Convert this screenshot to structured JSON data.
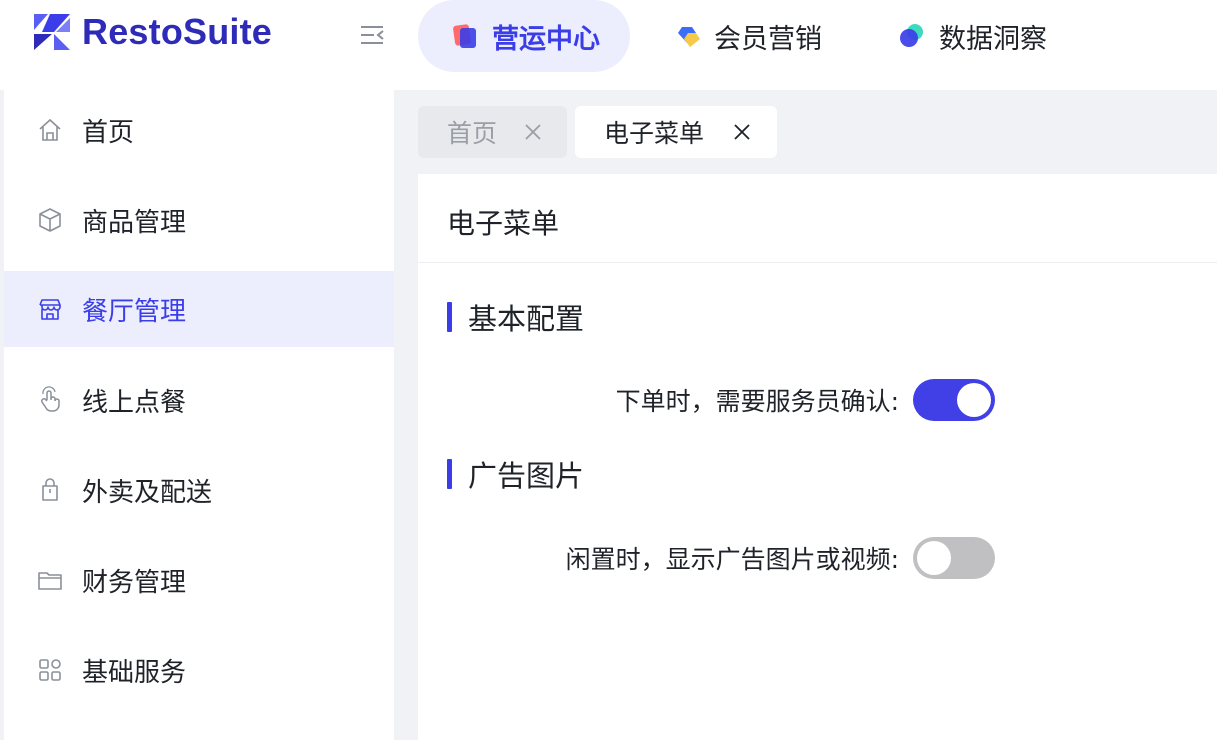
{
  "brand": {
    "name": "RestoSuite"
  },
  "top_nav": [
    {
      "label": "营运中心",
      "icon": "operations-icon",
      "active": true
    },
    {
      "label": "会员营销",
      "icon": "membership-icon",
      "active": false
    },
    {
      "label": "数据洞察",
      "icon": "insights-icon",
      "active": false
    }
  ],
  "sidebar": {
    "items": [
      {
        "label": "首页",
        "icon": "home-icon"
      },
      {
        "label": "商品管理",
        "icon": "box-icon"
      },
      {
        "label": "餐厅管理",
        "icon": "store-icon",
        "active": true
      },
      {
        "label": "线上点餐",
        "icon": "tap-hand-icon"
      },
      {
        "label": "外卖及配送",
        "icon": "bag-icon"
      },
      {
        "label": "财务管理",
        "icon": "folder-icon"
      },
      {
        "label": "基础服务",
        "icon": "grid-icon"
      }
    ]
  },
  "tabs": [
    {
      "label": "首页",
      "active": false
    },
    {
      "label": "电子菜单",
      "active": true
    }
  ],
  "panel": {
    "title": "电子菜单",
    "sections": [
      {
        "title": "基本配置",
        "field_label": "下单时，需要服务员确认:",
        "switch_on": true
      },
      {
        "title": "广告图片",
        "field_label": "闲置时，显示广告图片或视频:",
        "switch_on": false
      }
    ]
  },
  "colors": {
    "accent": "#3b3ee8",
    "active_bg": "#eceefd",
    "switch_off": "#c0c0c2"
  }
}
